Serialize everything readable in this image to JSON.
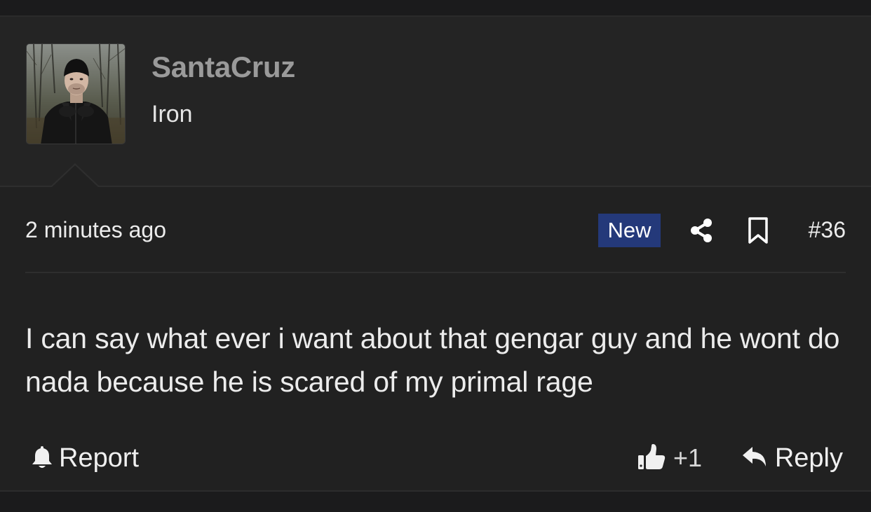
{
  "post": {
    "author": {
      "username": "SantaCruz",
      "rank": "Iron",
      "avatar_icon": "user-avatar-photo"
    },
    "meta": {
      "timestamp": "2 minutes ago",
      "badge": "New",
      "badge_color": "#24397a",
      "share_icon": "share-icon",
      "bookmark_icon": "bookmark-icon",
      "post_number": "#36"
    },
    "body": "I can say what ever i want about that gengar guy and he wont do nada because he is scared of my primal rage",
    "actions": {
      "report_label": "Report",
      "report_icon": "bell-icon",
      "like_icon": "thumbs-up-icon",
      "like_count": "+1",
      "reply_icon": "reply-arrow-icon",
      "reply_label": "Reply"
    }
  }
}
